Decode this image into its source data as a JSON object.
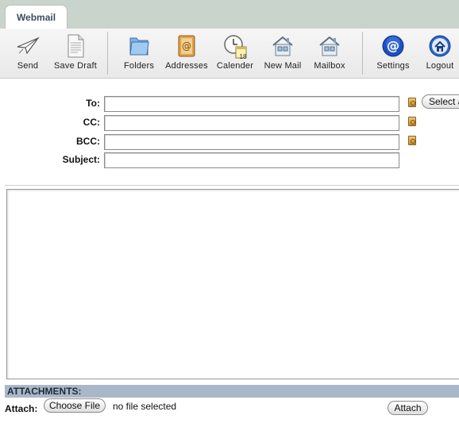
{
  "tabbar": {
    "active_tab": "Webmail"
  },
  "toolbar": {
    "items": [
      {
        "label": "Send",
        "icon": "paper-plane-icon"
      },
      {
        "label": "Save Draft",
        "icon": "document-icon"
      },
      {
        "label": "Folders",
        "icon": "folder-icon"
      },
      {
        "label": "Addresses",
        "icon": "address-book-icon"
      },
      {
        "label": "Calender",
        "icon": "clock-calendar-icon"
      },
      {
        "label": "New Mail",
        "icon": "house-icon"
      },
      {
        "label": "Mailbox",
        "icon": "house-icon"
      },
      {
        "label": "Settings",
        "icon": "at-sign-icon"
      },
      {
        "label": "Logout",
        "icon": "home-icon"
      }
    ],
    "calendar_day": "18"
  },
  "compose": {
    "to_label": "To:",
    "cc_label": "CC:",
    "bcc_label": "BCC:",
    "subject_label": "Subject:",
    "to_value": "",
    "cc_value": "",
    "bcc_value": "",
    "subject_value": "",
    "select_button": "Select a",
    "body_value": ""
  },
  "attachments": {
    "header": "ATTACHMENTS:",
    "attach_label": "Attach:",
    "choose_file": "Choose File",
    "no_file": "no file selected",
    "attach_button": "Attach"
  },
  "colors": {
    "tabbar_bg": "#c9d4cc",
    "attachments_bar": "#a9b8c8",
    "settings_blue": "#1d4fc4"
  }
}
